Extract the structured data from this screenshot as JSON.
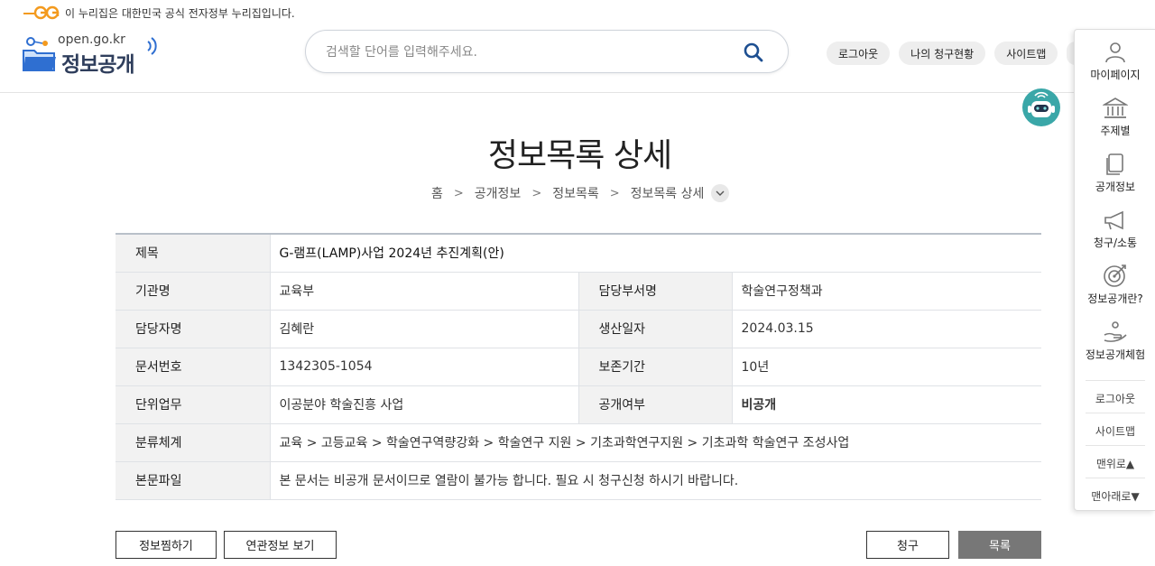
{
  "gov_banner": {
    "text": "이 누리집은 대한민국 공식 전자정부 누리집입니다."
  },
  "logo": {
    "domain": "open.go.kr",
    "title": "정보공개"
  },
  "search": {
    "placeholder": "검색할 단어를 입력해주세요."
  },
  "top_buttons": [
    "로그아웃",
    "나의 청구현황",
    "사이트맵"
  ],
  "side_menu": {
    "items": [
      {
        "label": "마이페이지",
        "icon": "person-icon"
      },
      {
        "label": "주제별",
        "icon": "building-icon"
      },
      {
        "label": "공개정보",
        "icon": "document-icon"
      },
      {
        "label": "청구/소통",
        "icon": "megaphone-icon"
      },
      {
        "label": "정보공개란?",
        "icon": "target-icon"
      },
      {
        "label": "정보공개체험",
        "icon": "hand-icon"
      }
    ],
    "logout": "로그아웃",
    "sitemap": "사이트맵",
    "to_top": "맨위로▲",
    "to_bottom": "맨아래로▼"
  },
  "page_title": "정보목록 상세",
  "breadcrumb": [
    "홈",
    "공개정보",
    "정보목록",
    "정보목록 상세"
  ],
  "detail": {
    "title_label": "제목",
    "title_value": "G-램프(LAMP)사업 2024년 추진계획(안)",
    "rows": [
      {
        "l1": "기관명",
        "v1": "교육부",
        "l2": "담당부서명",
        "v2": "학술연구정책과"
      },
      {
        "l1": "담당자명",
        "v1": "김혜란",
        "l2": "생산일자",
        "v2": "2024.03.15"
      },
      {
        "l1": "문서번호",
        "v1": "1342305-1054",
        "l2": "보존기간",
        "v2": "10년"
      },
      {
        "l1": "단위업무",
        "v1": "이공분야 학술진흥 사업",
        "l2": "공개여부",
        "v2": "비공개"
      }
    ],
    "category_label": "분류체계",
    "category_value": "교육 > 고등교육 > 학술연구역량강화 > 학술연구 지원 > 기초과학연구지원 > 기초과학 학술연구 조성사업",
    "file_label": "본문파일",
    "file_value": "본 문서는 비공개 문서이므로 열람이 불가능 합니다. 필요 시 청구신청 하시기 바랍니다."
  },
  "buttons": {
    "bookmark": "정보찜하기",
    "related": "연관정보 보기",
    "request": "청구",
    "list": "목록"
  },
  "colors": {
    "accent": "#1d4f91",
    "logo_orange": "#f39a1e",
    "logo_blue": "#2f6fd1"
  }
}
